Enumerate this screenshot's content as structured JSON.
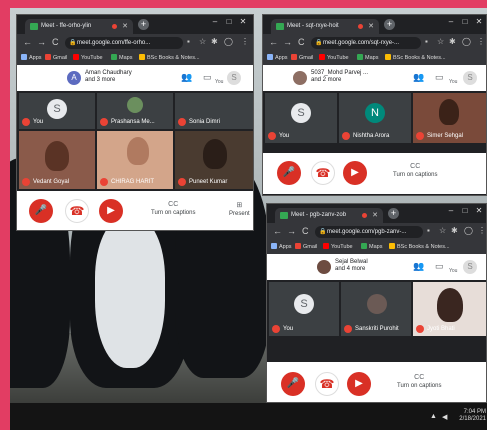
{
  "browser": {
    "new_tab": "+",
    "nav": {
      "back": "←",
      "forward": "→",
      "reload": "C"
    },
    "bookmarks": [
      "Apps",
      "Gmail",
      "YouTube",
      "Maps",
      "BSc Books & Notes..."
    ],
    "controls": {
      "minimize": "–",
      "maximize": "□",
      "close": "✕"
    }
  },
  "windows": [
    {
      "tab_title": "Meet - ffe-orho-ylin",
      "url": "meet.google.com/ffe-orho...",
      "participants": {
        "avatar": "A",
        "name": "Aman Chaudhary",
        "more": "and 3 more"
      },
      "you_label": "You",
      "tiles": [
        {
          "name": "You",
          "avatar": "S"
        },
        {
          "name": "Prashansa Me...",
          "avatar": ""
        },
        {
          "name": "Sonia Dimri",
          "avatar": ""
        },
        {
          "name": "Vedant Goyal",
          "avatar": ""
        },
        {
          "name": "CHIRAG HARIT",
          "avatar": ""
        },
        {
          "name": "Puneet Kumar",
          "avatar": ""
        }
      ],
      "captions": "Turn on captions",
      "present": "Present"
    },
    {
      "tab_title": "Meet - sqt-rxye-hoit",
      "url": "meet.google.com/sqt-rxye-...",
      "participants": {
        "avatar": "",
        "name": "5037_Mohd Parvej ...",
        "more": "and 2 more"
      },
      "you_label": "You",
      "tiles": [
        {
          "name": "You",
          "avatar": "S"
        },
        {
          "name": "Nishtha Arora",
          "avatar": "N"
        },
        {
          "name": "Simer Sehgal",
          "avatar": ""
        }
      ],
      "captions": "Turn on captions"
    },
    {
      "tab_title": "Meet - pgb-zanv-zob",
      "url": "meet.google.com/pgb-zanv-...",
      "participants": {
        "avatar": "",
        "name": "Sejal Belwal",
        "more": "and 4 more"
      },
      "you_label": "You",
      "tiles": [
        {
          "name": "You",
          "avatar": "S"
        },
        {
          "name": "Sanskriti Purohit",
          "avatar": ""
        },
        {
          "name": "Jyoti Bhati",
          "avatar": ""
        }
      ],
      "captions": "Turn on captions"
    }
  ],
  "taskbar": {
    "time": "7:04 PM",
    "date": "2/18/2021"
  },
  "colors": {
    "frame": "#e23d63",
    "meet_red": "#d93025",
    "chrome_dark": "#202124"
  }
}
